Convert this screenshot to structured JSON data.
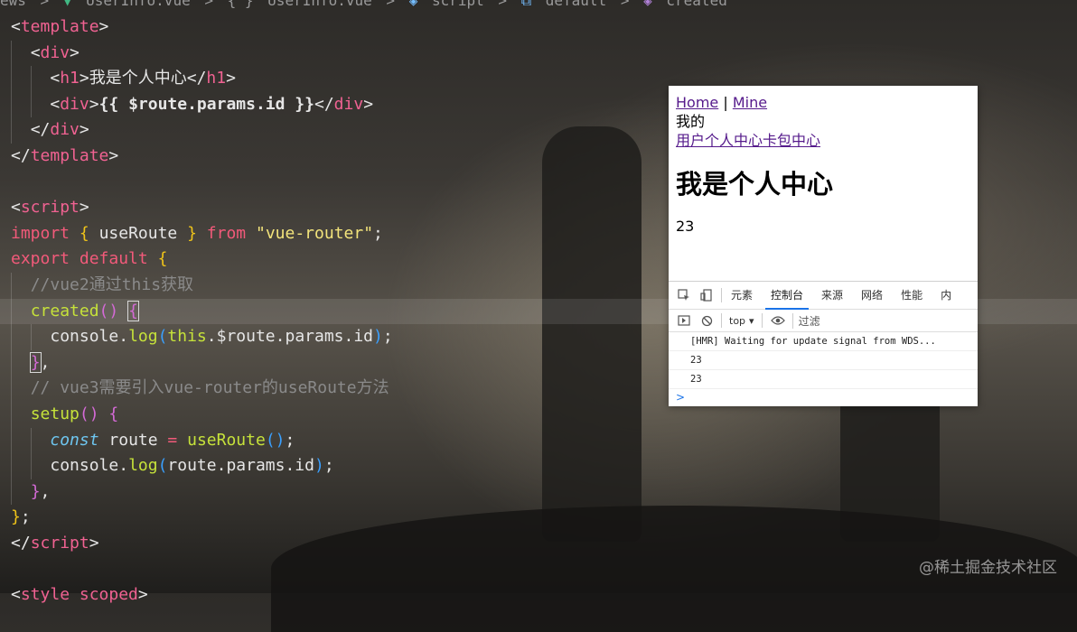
{
  "breadcrumb": [
    "ews",
    ">",
    "UserInfo.vue",
    ">",
    "{ }",
    "UserInfo.vue",
    ">",
    "script",
    ">",
    "default",
    ">",
    "created"
  ],
  "code": {
    "l1": "<template>",
    "h1_text": "我是个人中心",
    "div_expr": "{{ $route.params.id }}",
    "import_name": "useRoute",
    "import_from": "\"vue-router\"",
    "comment1": "//vue2通过this获取",
    "created": "created",
    "log1": "console.log(this.$route.params.id);",
    "comment2": "// vue3需要引入vue-router的useRoute方法",
    "setup": "setup",
    "const_line_var": "route",
    "const_line_fn": "useRoute",
    "log2": "console.log(route.params.id);",
    "style_partial": "<style scoped>"
  },
  "browser": {
    "nav_home": "Home",
    "nav_sep": "|",
    "nav_mine": "Mine",
    "text_mine": "我的",
    "link_card": "用户个人中心卡包中心",
    "heading": "我是个人中心",
    "param_value": "23"
  },
  "devtools": {
    "tabs": [
      "元素",
      "控制台",
      "来源",
      "网络",
      "性能",
      "内"
    ],
    "active_tab": "控制台",
    "context": "top",
    "filter_placeholder": "过滤",
    "messages": [
      "[HMR] Waiting for update signal from WDS...",
      "23",
      "23"
    ],
    "prompt": ">"
  },
  "watermark": "@稀土掘金技术社区"
}
